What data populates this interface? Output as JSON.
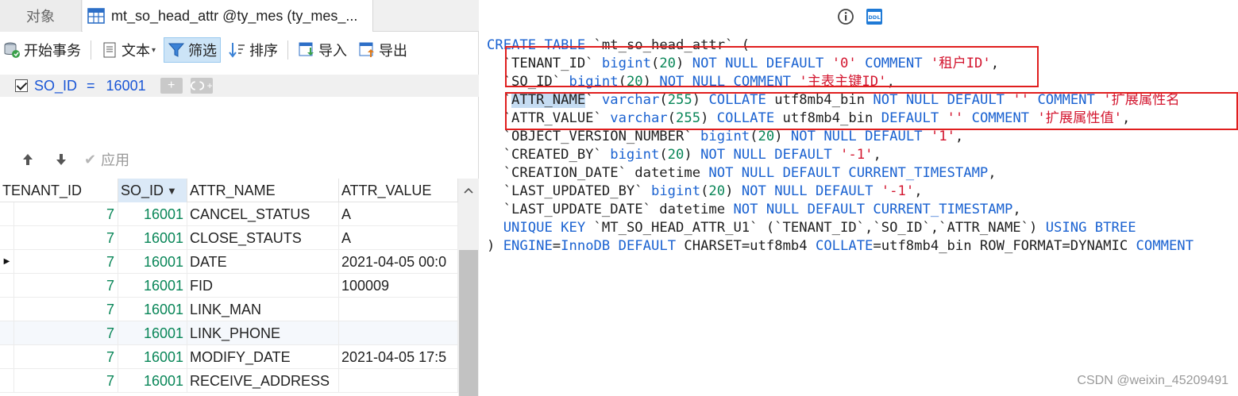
{
  "tabs": {
    "objects": "对象",
    "active": "mt_so_head_attr @ty_mes (ty_mes_..."
  },
  "toolbar": {
    "begin_tx": "开始事务",
    "text": "文本",
    "filter": "筛选",
    "sort": "排序",
    "import": "导入",
    "export": "导出"
  },
  "filter": {
    "column": "SO_ID",
    "operator": "=",
    "value": "16001",
    "add": "+",
    "add_group": "+"
  },
  "nav": {
    "apply": "应用"
  },
  "grid": {
    "columns": [
      "TENANT_ID",
      "SO_ID",
      "ATTR_NAME",
      "ATTR_VALUE"
    ],
    "rows": [
      [
        "7",
        "16001",
        "CANCEL_STATUS",
        "A"
      ],
      [
        "7",
        "16001",
        "CLOSE_STAUTS",
        "A"
      ],
      [
        "7",
        "16001",
        "DATE",
        "2021-04-05 00:0"
      ],
      [
        "7",
        "16001",
        "FID",
        "100009"
      ],
      [
        "7",
        "16001",
        "LINK_MAN",
        ""
      ],
      [
        "7",
        "16001",
        "LINK_PHONE",
        ""
      ],
      [
        "7",
        "16001",
        "MODIFY_DATE",
        "2021-04-05 17:5"
      ],
      [
        "7",
        "16001",
        "RECEIVE_ADDRESS",
        ""
      ]
    ]
  },
  "ddl_icon_label": "DDL",
  "watermark": "CSDN @weixin_45209491",
  "colors": {
    "keyword": "#1a62d1",
    "number": "#098658",
    "string": "#d3162f",
    "redbox": "#e01e1e",
    "selected_tab": "#cce4f7"
  }
}
